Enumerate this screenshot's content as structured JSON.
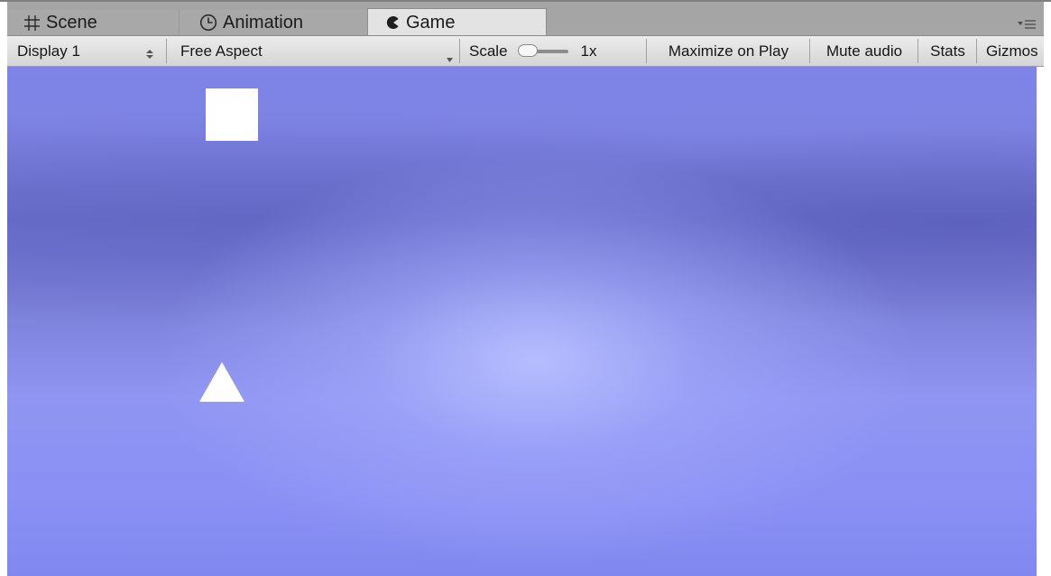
{
  "tabs": [
    {
      "label": "Scene",
      "icon": "grid-hash-icon"
    },
    {
      "label": "Animation",
      "icon": "clock-icon"
    },
    {
      "label": "Game",
      "icon": "pacman-icon",
      "active": true
    }
  ],
  "tab_menu_icon": "tab-menu-icon",
  "toolbar": {
    "display": {
      "label": "Display 1",
      "icon": "up-down-arrows-icon"
    },
    "aspect": {
      "label": "Free Aspect",
      "icon": "dropdown-arrow-icon"
    },
    "scale": {
      "label": "Scale",
      "value_label": "1x",
      "value": 1
    },
    "maximize_on_play": "Maximize on Play",
    "mute_audio": "Mute audio",
    "stats": "Stats",
    "gizmos": "Gizmos"
  },
  "game_view": {
    "objects": [
      {
        "shape": "square",
        "color": "#ffffff"
      },
      {
        "shape": "triangle",
        "color": "#ffffff"
      }
    ],
    "background_colors": [
      "#7f85e8",
      "#6a70cc",
      "#b9c0ff",
      "#8a90f4"
    ]
  },
  "colors": {
    "tab_strip": "#a5a5a5",
    "active_tab": "#e3e3e3",
    "toolbar": "#e0e0e0"
  }
}
